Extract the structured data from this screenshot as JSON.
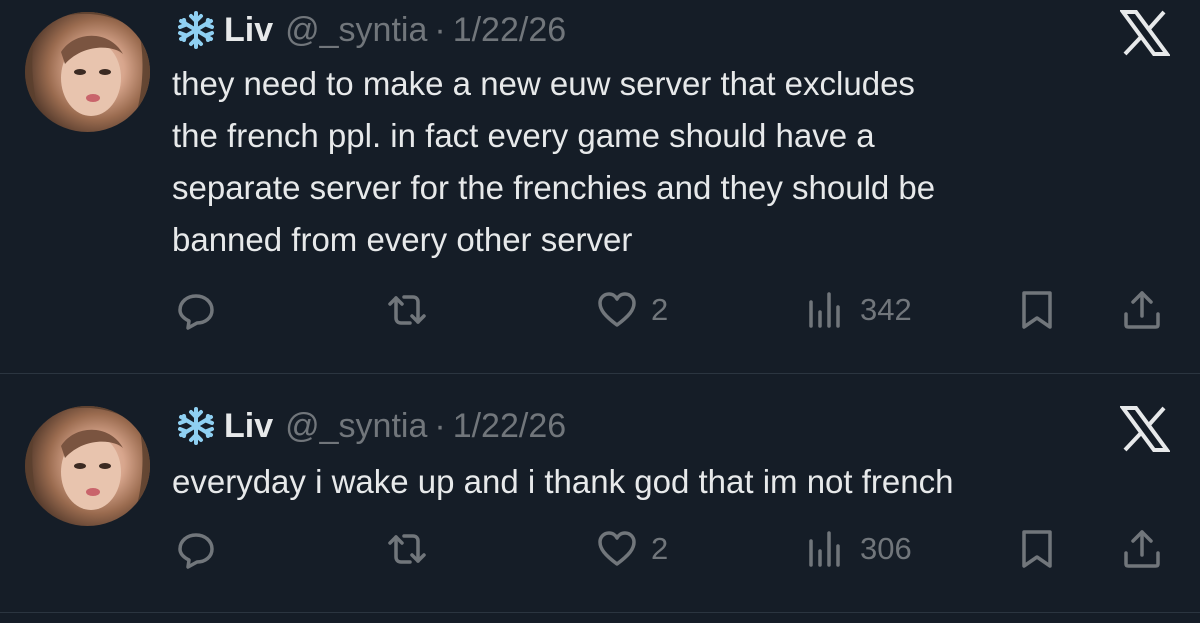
{
  "tweets": [
    {
      "display_name": "Liv",
      "handle": "@_syntia",
      "separator": "·",
      "date": "1/22/26",
      "text_lines": [
        "they need to make a new euw server that excludes",
        "the french ppl. in fact every game should have a",
        "separate server for the frenchies and they should be",
        "banned from every other server"
      ],
      "like_count": "2",
      "view_count": "342",
      "name_icon": "snowflake-icon",
      "brand_icon": "x-logo-icon"
    },
    {
      "display_name": "Liv",
      "handle": "@_syntia",
      "separator": "·",
      "date": "1/22/26",
      "text_lines": [
        "everyday i wake up and i thank god that im not french"
      ],
      "like_count": "2",
      "view_count": "306",
      "name_icon": "snowflake-icon",
      "brand_icon": "x-logo-icon"
    }
  ],
  "colors": {
    "background": "#151d27",
    "primary_text": "#e7e9ea",
    "secondary_text": "#71767b",
    "divider": "#2b3540",
    "snowflake": "#8fd0f2"
  }
}
